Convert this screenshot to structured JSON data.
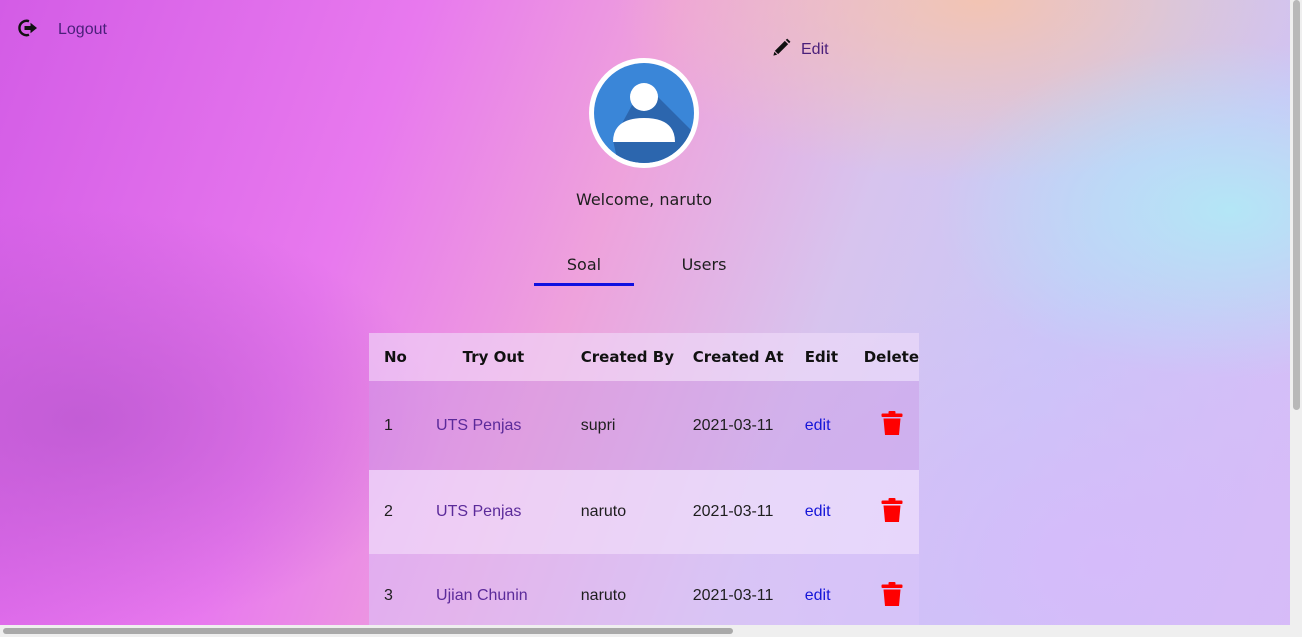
{
  "header": {
    "logout_label": "Logout",
    "edit_label": "Edit",
    "welcome_text": "Welcome, naruto"
  },
  "tabs": [
    {
      "label": "Soal",
      "active": true
    },
    {
      "label": "Users",
      "active": false
    }
  ],
  "table": {
    "columns": [
      "No",
      "Try Out",
      "Created By",
      "Created At",
      "Edit",
      "Delete"
    ],
    "rows": [
      {
        "no": "1",
        "try_out": "UTS Penjas",
        "created_by": "supri",
        "created_at": "2021-03-11",
        "edit": "edit"
      },
      {
        "no": "2",
        "try_out": "UTS Penjas",
        "created_by": "naruto",
        "created_at": "2021-03-11",
        "edit": "edit"
      },
      {
        "no": "3",
        "try_out": "Ujian Chunin",
        "created_by": "naruto",
        "created_at": "2021-03-11",
        "edit": "edit"
      }
    ]
  },
  "icons": {
    "logout": "logout-icon",
    "edit": "pencil-icon",
    "avatar": "user-avatar-icon",
    "delete": "trash-icon"
  },
  "colors": {
    "tab_active_underline": "#1010e0",
    "link_purple": "#5b2a9a",
    "link_blue": "#1515d8",
    "delete_red": "#ff0000",
    "avatar_blue": "#3a86d8"
  }
}
